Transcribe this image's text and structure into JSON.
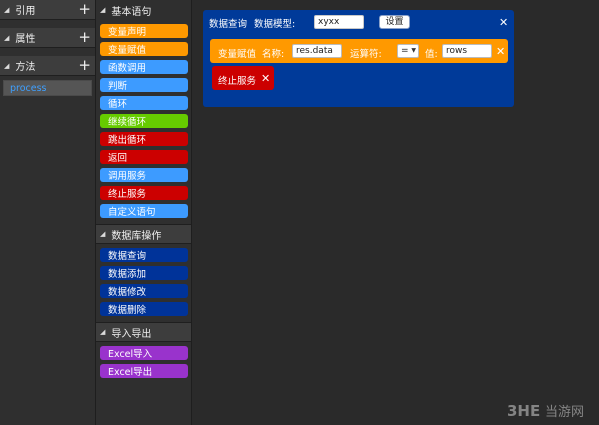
{
  "left_panel": {
    "sections": [
      {
        "title": "引用",
        "add": "+"
      },
      {
        "title": "属性",
        "add": "+"
      },
      {
        "title": "方法",
        "add": "+"
      }
    ],
    "methods": [
      "process"
    ]
  },
  "palette": {
    "groups": [
      {
        "title": "基本语句",
        "blocks": [
          {
            "label": "变量声明",
            "color": "#ff9900"
          },
          {
            "label": "变量赋值",
            "color": "#ff9900"
          },
          {
            "label": "函数调用",
            "color": "#3d9bff"
          },
          {
            "label": "判断",
            "color": "#3d9bff"
          },
          {
            "label": "循环",
            "color": "#3d9bff"
          },
          {
            "label": "继续循环",
            "color": "#66cc00"
          },
          {
            "label": "跳出循环",
            "color": "#cc0000"
          },
          {
            "label": "返回",
            "color": "#cc0000"
          },
          {
            "label": "调用服务",
            "color": "#3d9bff"
          },
          {
            "label": "终止服务",
            "color": "#cc0000"
          },
          {
            "label": "自定义语句",
            "color": "#3d9bff"
          }
        ]
      },
      {
        "title": "数据库操作",
        "blocks": [
          {
            "label": "数据查询",
            "color": "#003399"
          },
          {
            "label": "数据添加",
            "color": "#003399"
          },
          {
            "label": "数据修改",
            "color": "#003399"
          },
          {
            "label": "数据删除",
            "color": "#003399"
          }
        ]
      },
      {
        "title": "导入导出",
        "blocks": [
          {
            "label": "Excel导入",
            "color": "#9933cc"
          },
          {
            "label": "Excel导出",
            "color": "#9933cc"
          }
        ]
      }
    ]
  },
  "canvas": {
    "query": {
      "title": "数据查询",
      "model_label": "数据模型:",
      "model_value": "xyxx",
      "button": "设置",
      "close": "✕",
      "color": "#003a99"
    },
    "assign": {
      "title": "变量赋值",
      "name_label": "名称:",
      "name_value": "res.data",
      "op_label": "运算符:",
      "op_value": "=",
      "value_label": "值:",
      "value_value": "rows",
      "close": "✕",
      "color": "#ff9900"
    },
    "stop": {
      "title": "终止服务",
      "close": "✕",
      "color": "#cc0000"
    }
  },
  "watermark": {
    "text": "3HE当游网"
  }
}
